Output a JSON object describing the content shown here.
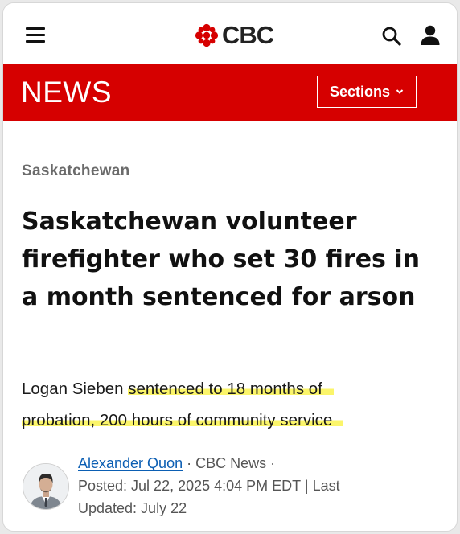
{
  "header": {
    "logo_text": "CBC",
    "brand_color": "#d60000",
    "icons": [
      "menu-icon",
      "cbc-gem-icon",
      "search-icon",
      "user-icon"
    ]
  },
  "newsbar": {
    "title": "NEWS",
    "sections_label": "Sections"
  },
  "article": {
    "section": "Saskatchewan",
    "headline": "Saskatchewan volunteer firefighter who set 30 fires in a month sentenced for arson",
    "deck_name": "Logan Sieben",
    "deck_highlighted_1": "sentenced to 18 months of",
    "deck_highlighted_2": "probation, 200 hours of community service",
    "highlight_color": "#fbf56a"
  },
  "byline": {
    "author": "Alexander Quon",
    "outlet": "CBC News",
    "separator": "·",
    "posted": "Posted: Jul 22, 2025 4:04 PM EDT",
    "pipe": "|",
    "updated_prefix": "Last",
    "updated": "Updated: July 22"
  }
}
